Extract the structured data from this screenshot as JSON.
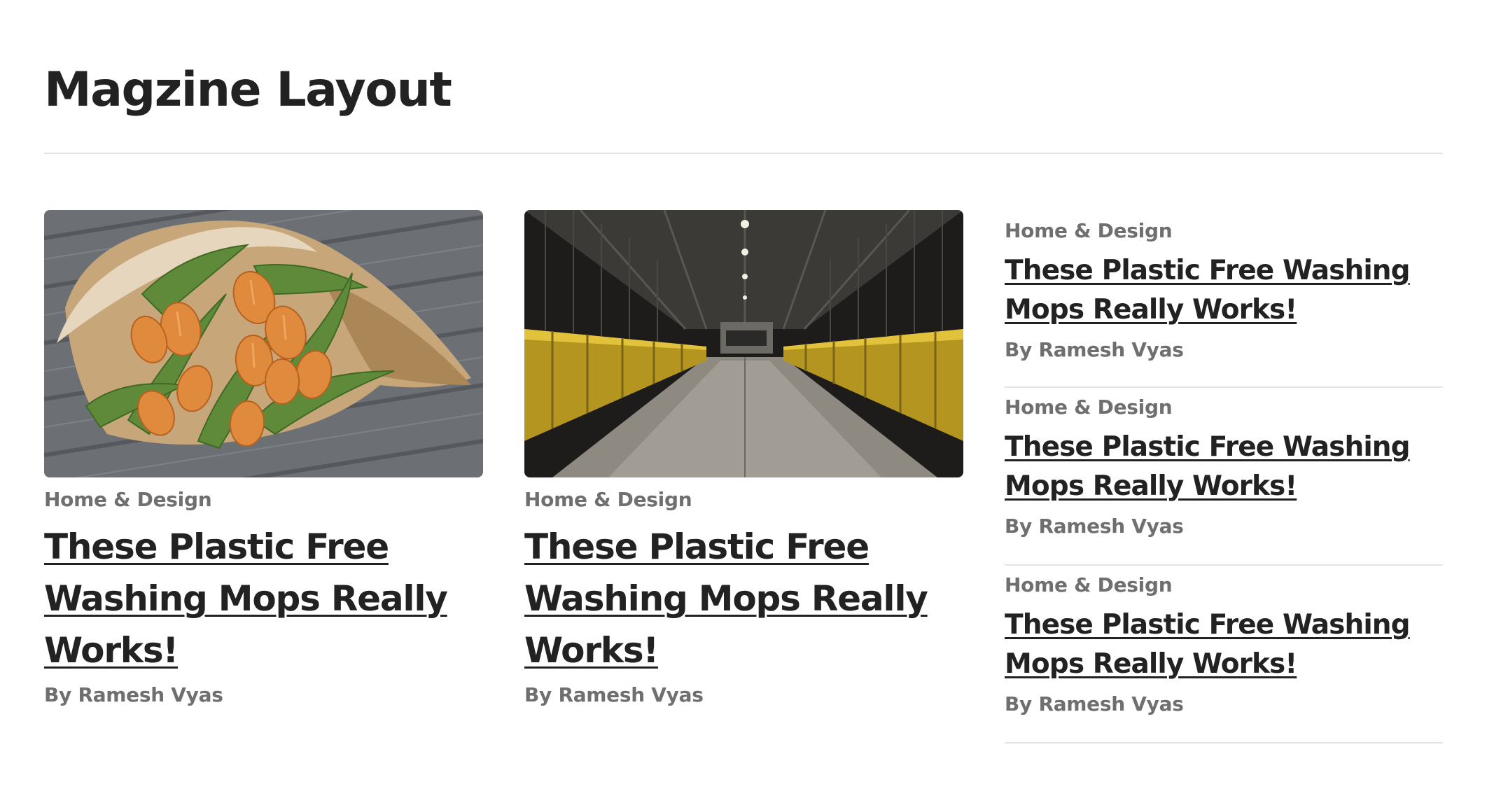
{
  "page": {
    "title": "Magzine Layout"
  },
  "featured": [
    {
      "image_alt": "tulips-bouquet-image",
      "category": "Home & Design",
      "headline": "These Plastic Free Washing Mops Really Works!",
      "author": "By Ramesh Vyas"
    },
    {
      "image_alt": "yellow-walkway-bridge-image",
      "category": "Home & Design",
      "headline": "These Plastic Free Washing Mops Really Works!",
      "author": "By Ramesh Vyas"
    }
  ],
  "side_list": [
    {
      "category": "Home & Design",
      "headline": "These Plastic Free Washing Mops Really Works!",
      "author": "By Ramesh Vyas"
    },
    {
      "category": "Home & Design",
      "headline": "These Plastic Free Washing Mops Really Works!",
      "author": "By Ramesh Vyas"
    },
    {
      "category": "Home & Design",
      "headline": "These Plastic Free Washing Mops Really Works!",
      "author": "By Ramesh Vyas"
    }
  ],
  "colors": {
    "text_dark": "#222222",
    "text_muted": "#6f6f6f",
    "divider": "#e3e3e3",
    "background": "#ffffff"
  }
}
